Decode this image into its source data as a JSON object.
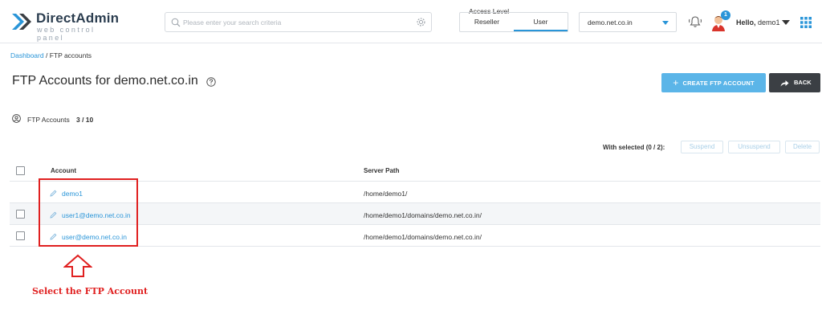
{
  "header": {
    "logo_title": "DirectAdmin",
    "logo_subtitle": "web control panel",
    "search_placeholder": "Please enter your search criteria",
    "access_level_title": "Access Level",
    "access_options": [
      "Reseller",
      "User"
    ],
    "access_selected": "User",
    "domain_selected": "demo.net.co.in",
    "notification_count": "1",
    "greeting": "Hello,",
    "username": "demo1"
  },
  "breadcrumb": {
    "root": "Dashboard",
    "separator": " / ",
    "current": "FTP accounts"
  },
  "page": {
    "title": "FTP Accounts for demo.net.co.in",
    "create_button": "CREATE FTP ACCOUNT",
    "back_button": "BACK",
    "count_label": "FTP Accounts",
    "count_value": "3 / 10"
  },
  "bulk_actions": {
    "label": "With selected (0 / 2):",
    "suspend": "Suspend",
    "unsuspend": "Unsuspend",
    "delete": "Delete"
  },
  "table": {
    "columns": [
      "Account",
      "Server Path"
    ],
    "rows": [
      {
        "account": "demo1",
        "path": "/home/demo1/"
      },
      {
        "account": "user1@demo.net.co.in",
        "path": "/home/demo1/domains/demo.net.co.in/"
      },
      {
        "account": "user@demo.net.co.in",
        "path": "/home/demo1/domains/demo.net.co.in/"
      }
    ]
  },
  "annotation": {
    "text": "Select the FTP Account",
    "color": "#e02020"
  },
  "colors": {
    "accent": "#2a95d8",
    "create_button": "#5bb5e8",
    "back_button": "#3b3f44"
  }
}
